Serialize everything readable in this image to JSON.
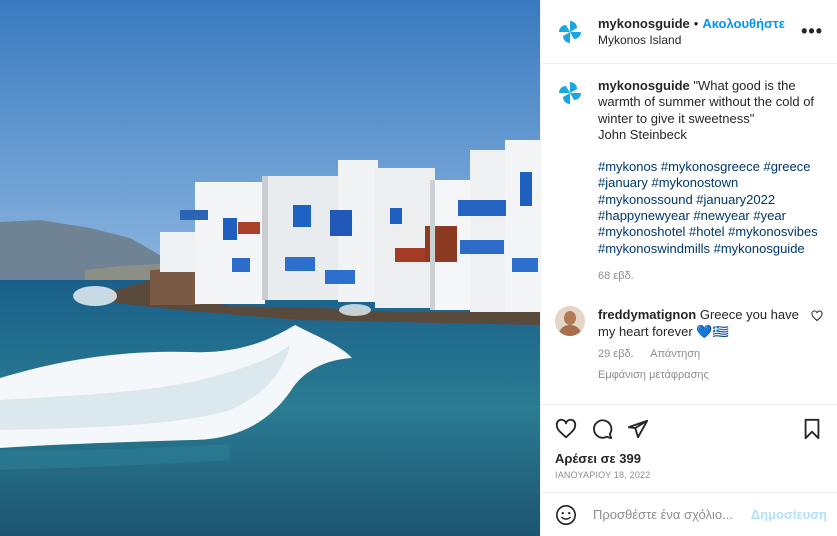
{
  "header": {
    "username": "mykonosguide",
    "separator": "•",
    "follow_label": "Ακολουθήστε",
    "location": "Mykonos Island",
    "more_label": "•••"
  },
  "caption": {
    "username": "mykonosguide",
    "text": "\"What good is the warmth of summer without the cold of winter to give it sweetness\"",
    "author": "John Steinbeck",
    "hashtags": "#mykonos #mykonosgreece #greece #january #mykonostown #mykonossound #january2022 #happynewyear #newyear #year #mykonoshotel #hotel #mykonosvibes #mykonoswindmills #mykonosguide",
    "age": "68 εβδ."
  },
  "comment": {
    "username": "freddymatignon",
    "text": "Greece you have my heart forever 💙🇬🇷",
    "age": "29 εβδ.",
    "reply_label": "Απάντηση",
    "translate_label": "Εμφάνιση μετάφρασης"
  },
  "actions": {
    "likes": "Αρέσει σε 399",
    "date": "ΙΑΝΟΥΑΡΙΟΥ 18, 2022"
  },
  "add_comment": {
    "placeholder": "Προσθέστε ένα σχόλιο...",
    "post_label": "Δημοσίευση"
  },
  "colors": {
    "accent": "#0095f6",
    "hashtag": "#00376b",
    "muted": "#8e8e8e",
    "logo_blue": "#1aa6e0"
  },
  "icons": [
    "pinwheel-logo-icon",
    "more-options-icon",
    "heart-icon",
    "comment-icon",
    "share-icon",
    "bookmark-icon",
    "emoji-icon",
    "small-heart-icon"
  ]
}
